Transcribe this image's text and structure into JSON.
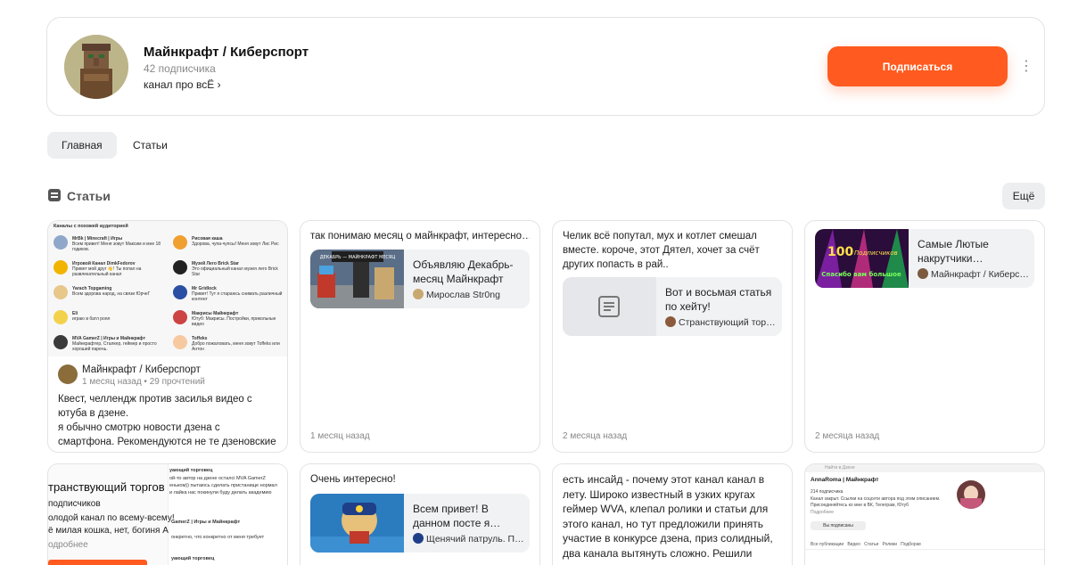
{
  "channel": {
    "title": "Майнкрафт / Киберспорт",
    "subscribers": "42 подписчика",
    "description": "канал про всЁ",
    "subscribe_label": "Подписаться"
  },
  "tabs": [
    {
      "label": "Главная",
      "active": true
    },
    {
      "label": "Статьи",
      "active": false
    }
  ],
  "section": {
    "title": "Статьи",
    "more_label": "Ещё"
  },
  "cards": [
    {
      "author": "Майнкрафт / Киберспорт",
      "meta": "1 месяц назад • 29 прочтений",
      "text": "Квест, челлендж против засилья видео с ютуба в дзене.\nя обычно смотрю новости дзена с смартфона. Рекомендуются не те дзеновские каналы…",
      "screenshot": {
        "heading": "Каналы с похожей аудиторией",
        "left": [
          {
            "name": "MrBk | Minecraft | Игры",
            "desc": "Всем привет! Меня зовут Максим и мне 18 годиков."
          },
          {
            "name": "Игровой Канал DimkFedorov",
            "desc": "Привет мой друг 👋! Ты попал на развлекательный канал"
          },
          {
            "name": "Yarach Topgaming",
            "desc": "Всем здорова народ, на связи ЮрчеГ"
          },
          {
            "name": "Eli",
            "desc": "играю в батл роял"
          },
          {
            "name": "MVA GamerZ | Игры и Майнкрафт",
            "desc": "Майнкрафтер, Сталкер, геймер и просто хороший парень."
          }
        ],
        "right": [
          {
            "name": "Рисовая каша",
            "desc": "Здорова, чупа-чупсы! Меня зовут Лис Рис"
          },
          {
            "name": "Музей Лего Brick Star",
            "desc": "Это официальный канал музея лего Brick Star"
          },
          {
            "name": "Mr Gridlock",
            "desc": "Привет! Тут я стараюсь снимать различный контент"
          },
          {
            "name": "Макрисы Майнкрафт",
            "desc": "Ютуб: Макрисы. Постройки, прикольные видео"
          },
          {
            "name": "Toffeks",
            "desc": "Добро пожаловать, меня зовут Toffeks или Антон"
          }
        ]
      }
    },
    {
      "text": "так понимаю месяц о майнкрафт, интересно…",
      "embed_title": "Объявляю Декабрь-месяц Майнкрафт н…",
      "embed_author": "Мирослав Str0ng",
      "thumb_caption": "ДЕКАБРЬ — МАЙНКРАФТ МЕСЯЦ",
      "date": "1 месяц назад"
    },
    {
      "text": "Челик всё попутал, мух и котлет смешал вместе. короче, этот Дятел, хочет за счёт других попасть в рай..",
      "embed_title": "Вот и восьмая статья по хейту!",
      "embed_author": "Странствующий торг…",
      "date": "2 месяца назад"
    },
    {
      "embed_title": "Самые Лютые накрутчики…",
      "embed_author": "Майнкрафт / Киберс…",
      "thumb_number": "100",
      "thumb_line1": "Подписчиков",
      "thumb_line2": "Спасибо вам большое",
      "date": "2 месяца назад"
    },
    {
      "lines": [
        "уающий торговец",
        "ой-то автор на дзене осталсі MVA GamerZ",
        "еньком)) пытаюсь сделать пристанище нормал",
        "и лайка нас покинули буду делать академию",
        "транствующий торгов",
        "подписчиков",
        "олодой канал по всему-всему!",
        "GamerZ | Игры и Майнкрафт",
        "ё милая кошка, нет, богиня А",
        "онкретно, что конкретно от меня требует",
        "одробнее",
        "уающий торговец"
      ]
    },
    {
      "text": "Очень интересно!",
      "embed_title": "Всем привет! В данном посте я…",
      "embed_author": "Щенячий патруль. П…"
    },
    {
      "text": "есть инсайд - почему этот канал канал в лету. Широко известный в узких кругах геймер WVA, клепал ролики и статьи для этого канал, но тут предложили принять участие в конкурсе дзена, приз солидный, два канала вытянуть сложно. Решили заморозить и сконцентрироваться на основном канале."
    },
    {
      "search_hint": "Найти в Дзене",
      "name": "AnnaRoma | Майнкрафт",
      "subs": "214 подписчика",
      "desc": "Канал закрыт. Ссылки на соцсети автора под этим описанием. Присоединяйтесь ко мне в ВК, Телеграм, Ютуб",
      "more": "Подробнее",
      "button": "Вы подписаны",
      "tabs": "Все публикации   Видео   Статьи   Ролики   Подборки"
    }
  ]
}
